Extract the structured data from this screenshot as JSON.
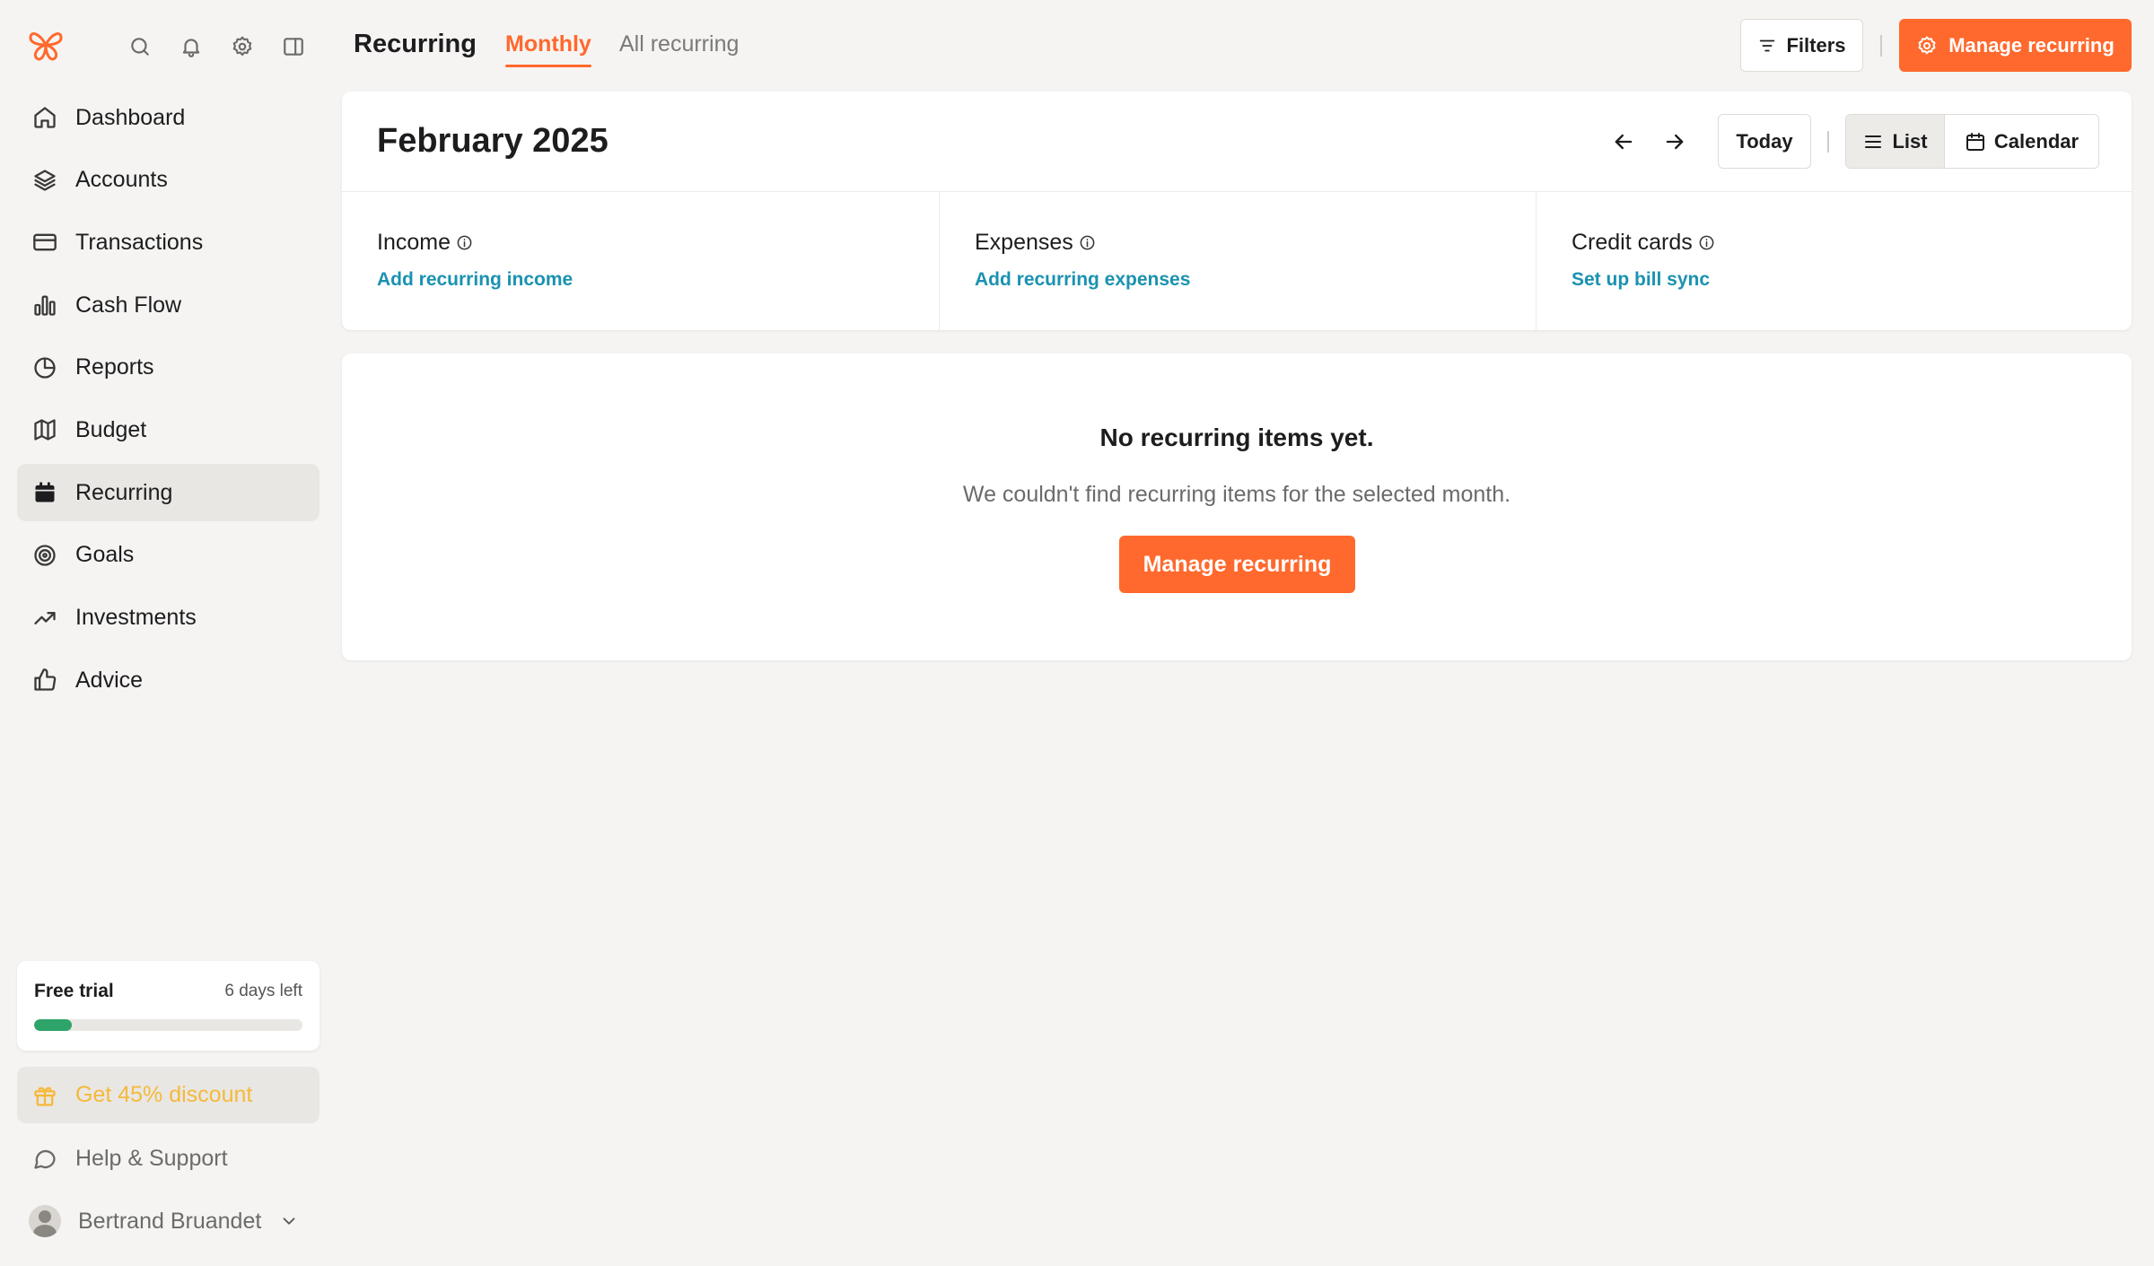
{
  "sidebar": {
    "top_icons": [
      "search-icon",
      "bell-icon",
      "gear-icon",
      "sidebar-toggle-icon"
    ],
    "items": [
      {
        "label": "Dashboard",
        "icon": "home-icon"
      },
      {
        "label": "Accounts",
        "icon": "layers-icon"
      },
      {
        "label": "Transactions",
        "icon": "credit-card-icon"
      },
      {
        "label": "Cash Flow",
        "icon": "bar-chart-icon"
      },
      {
        "label": "Reports",
        "icon": "pie-chart-icon"
      },
      {
        "label": "Budget",
        "icon": "map-icon"
      },
      {
        "label": "Recurring",
        "icon": "calendar-icon",
        "active": true
      },
      {
        "label": "Goals",
        "icon": "target-icon"
      },
      {
        "label": "Investments",
        "icon": "trending-up-icon"
      },
      {
        "label": "Advice",
        "icon": "thumbs-up-icon"
      }
    ],
    "trial": {
      "title": "Free trial",
      "days_left": "6 days left",
      "progress": 0.14
    },
    "discount_label": "Get 45% discount",
    "help_label": "Help & Support",
    "user_name": "Bertrand Bruandet"
  },
  "header": {
    "title": "Recurring",
    "tabs": [
      {
        "label": "Monthly",
        "active": true
      },
      {
        "label": "All recurring",
        "active": false
      }
    ],
    "filters_label": "Filters",
    "manage_label": "Manage recurring"
  },
  "month": {
    "title": "February 2025",
    "today_label": "Today",
    "views": [
      {
        "label": "List",
        "active": true
      },
      {
        "label": "Calendar",
        "active": false
      }
    ],
    "summary": [
      {
        "label": "Income",
        "link": "Add recurring income"
      },
      {
        "label": "Expenses",
        "link": "Add recurring expenses"
      },
      {
        "label": "Credit cards",
        "link": "Set up bill sync"
      }
    ]
  },
  "empty": {
    "title": "No recurring items yet.",
    "subtitle": "We couldn't find recurring items for the selected month.",
    "button_label": "Manage recurring"
  },
  "colors": {
    "accent": "#ff692d",
    "link": "#1a92b0",
    "progress": "#2fa46a",
    "discount": "#f5b93c",
    "background": "#f5f4f2"
  }
}
